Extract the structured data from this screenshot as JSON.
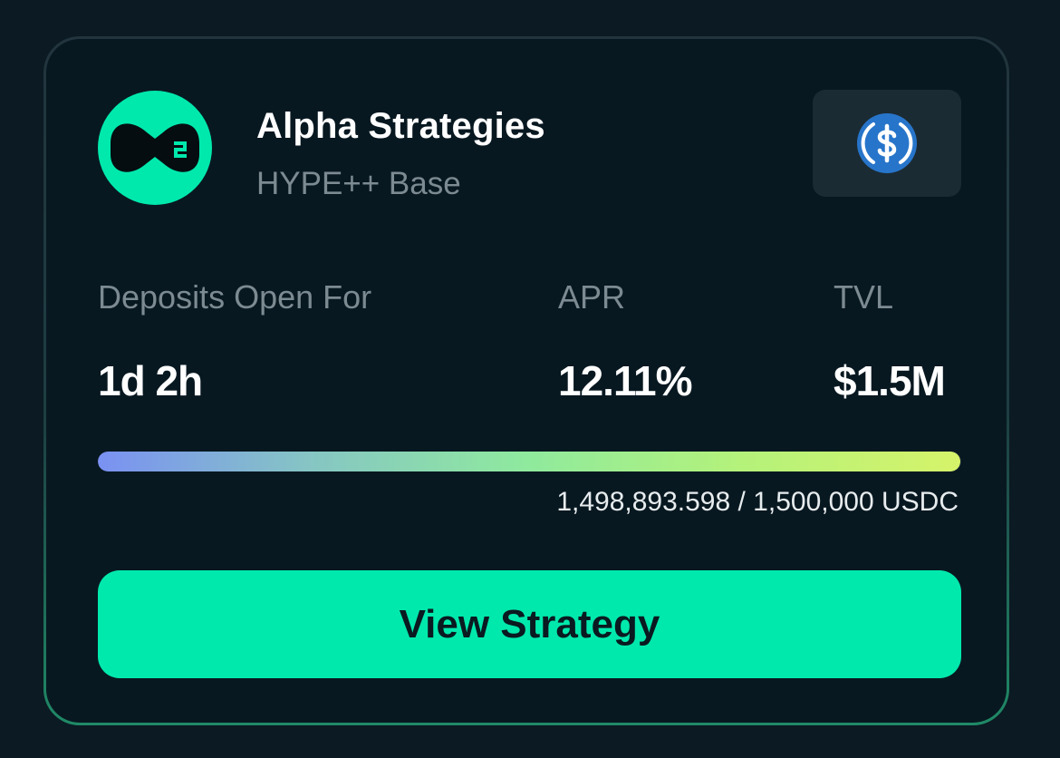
{
  "strategy": {
    "title": "Alpha Strategies",
    "subtitle": "HYPE++ Base",
    "logo_icon": "hyperbeat-logo-icon",
    "token_icon": "usdc-icon"
  },
  "stats": [
    {
      "label": "Deposits Open For",
      "value": "1d 2h"
    },
    {
      "label": "APR",
      "value": "12.11%"
    },
    {
      "label": "TVL",
      "value": "$1.5M"
    }
  ],
  "capacity": {
    "text": "1,498,893.598 / 1,500,000 USDC",
    "filled": 1498893.598,
    "cap": 1500000
  },
  "cta": {
    "label": "View Strategy"
  },
  "colors": {
    "accent": "#00e9ad",
    "card_background": "#081821",
    "page_background": "#0b1a23",
    "usdc_blue": "#2775ca",
    "muted_text": "#7c8a91"
  }
}
